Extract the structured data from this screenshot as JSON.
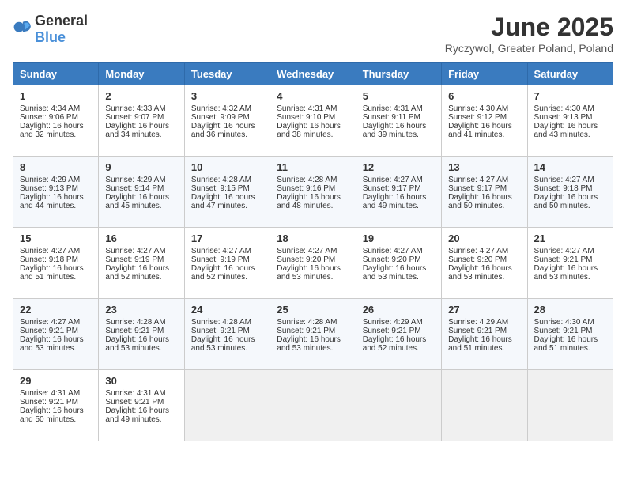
{
  "header": {
    "logo_general": "General",
    "logo_blue": "Blue",
    "title": "June 2025",
    "subtitle": "Ryczywol, Greater Poland, Poland"
  },
  "days_of_week": [
    "Sunday",
    "Monday",
    "Tuesday",
    "Wednesday",
    "Thursday",
    "Friday",
    "Saturday"
  ],
  "weeks": [
    [
      {
        "day": 1,
        "sunrise": "4:34 AM",
        "sunset": "9:06 PM",
        "daylight": "16 hours and 32 minutes."
      },
      {
        "day": 2,
        "sunrise": "4:33 AM",
        "sunset": "9:07 PM",
        "daylight": "16 hours and 34 minutes."
      },
      {
        "day": 3,
        "sunrise": "4:32 AM",
        "sunset": "9:09 PM",
        "daylight": "16 hours and 36 minutes."
      },
      {
        "day": 4,
        "sunrise": "4:31 AM",
        "sunset": "9:10 PM",
        "daylight": "16 hours and 38 minutes."
      },
      {
        "day": 5,
        "sunrise": "4:31 AM",
        "sunset": "9:11 PM",
        "daylight": "16 hours and 39 minutes."
      },
      {
        "day": 6,
        "sunrise": "4:30 AM",
        "sunset": "9:12 PM",
        "daylight": "16 hours and 41 minutes."
      },
      {
        "day": 7,
        "sunrise": "4:30 AM",
        "sunset": "9:13 PM",
        "daylight": "16 hours and 43 minutes."
      }
    ],
    [
      {
        "day": 8,
        "sunrise": "4:29 AM",
        "sunset": "9:13 PM",
        "daylight": "16 hours and 44 minutes."
      },
      {
        "day": 9,
        "sunrise": "4:29 AM",
        "sunset": "9:14 PM",
        "daylight": "16 hours and 45 minutes."
      },
      {
        "day": 10,
        "sunrise": "4:28 AM",
        "sunset": "9:15 PM",
        "daylight": "16 hours and 47 minutes."
      },
      {
        "day": 11,
        "sunrise": "4:28 AM",
        "sunset": "9:16 PM",
        "daylight": "16 hours and 48 minutes."
      },
      {
        "day": 12,
        "sunrise": "4:27 AM",
        "sunset": "9:17 PM",
        "daylight": "16 hours and 49 minutes."
      },
      {
        "day": 13,
        "sunrise": "4:27 AM",
        "sunset": "9:17 PM",
        "daylight": "16 hours and 50 minutes."
      },
      {
        "day": 14,
        "sunrise": "4:27 AM",
        "sunset": "9:18 PM",
        "daylight": "16 hours and 50 minutes."
      }
    ],
    [
      {
        "day": 15,
        "sunrise": "4:27 AM",
        "sunset": "9:18 PM",
        "daylight": "16 hours and 51 minutes."
      },
      {
        "day": 16,
        "sunrise": "4:27 AM",
        "sunset": "9:19 PM",
        "daylight": "16 hours and 52 minutes."
      },
      {
        "day": 17,
        "sunrise": "4:27 AM",
        "sunset": "9:19 PM",
        "daylight": "16 hours and 52 minutes."
      },
      {
        "day": 18,
        "sunrise": "4:27 AM",
        "sunset": "9:20 PM",
        "daylight": "16 hours and 53 minutes."
      },
      {
        "day": 19,
        "sunrise": "4:27 AM",
        "sunset": "9:20 PM",
        "daylight": "16 hours and 53 minutes."
      },
      {
        "day": 20,
        "sunrise": "4:27 AM",
        "sunset": "9:20 PM",
        "daylight": "16 hours and 53 minutes."
      },
      {
        "day": 21,
        "sunrise": "4:27 AM",
        "sunset": "9:21 PM",
        "daylight": "16 hours and 53 minutes."
      }
    ],
    [
      {
        "day": 22,
        "sunrise": "4:27 AM",
        "sunset": "9:21 PM",
        "daylight": "16 hours and 53 minutes."
      },
      {
        "day": 23,
        "sunrise": "4:28 AM",
        "sunset": "9:21 PM",
        "daylight": "16 hours and 53 minutes."
      },
      {
        "day": 24,
        "sunrise": "4:28 AM",
        "sunset": "9:21 PM",
        "daylight": "16 hours and 53 minutes."
      },
      {
        "day": 25,
        "sunrise": "4:28 AM",
        "sunset": "9:21 PM",
        "daylight": "16 hours and 53 minutes."
      },
      {
        "day": 26,
        "sunrise": "4:29 AM",
        "sunset": "9:21 PM",
        "daylight": "16 hours and 52 minutes."
      },
      {
        "day": 27,
        "sunrise": "4:29 AM",
        "sunset": "9:21 PM",
        "daylight": "16 hours and 51 minutes."
      },
      {
        "day": 28,
        "sunrise": "4:30 AM",
        "sunset": "9:21 PM",
        "daylight": "16 hours and 51 minutes."
      }
    ],
    [
      {
        "day": 29,
        "sunrise": "4:31 AM",
        "sunset": "9:21 PM",
        "daylight": "16 hours and 50 minutes."
      },
      {
        "day": 30,
        "sunrise": "4:31 AM",
        "sunset": "9:21 PM",
        "daylight": "16 hours and 49 minutes."
      },
      null,
      null,
      null,
      null,
      null
    ]
  ],
  "labels": {
    "sunrise": "Sunrise:",
    "sunset": "Sunset:",
    "daylight": "Daylight hours"
  }
}
